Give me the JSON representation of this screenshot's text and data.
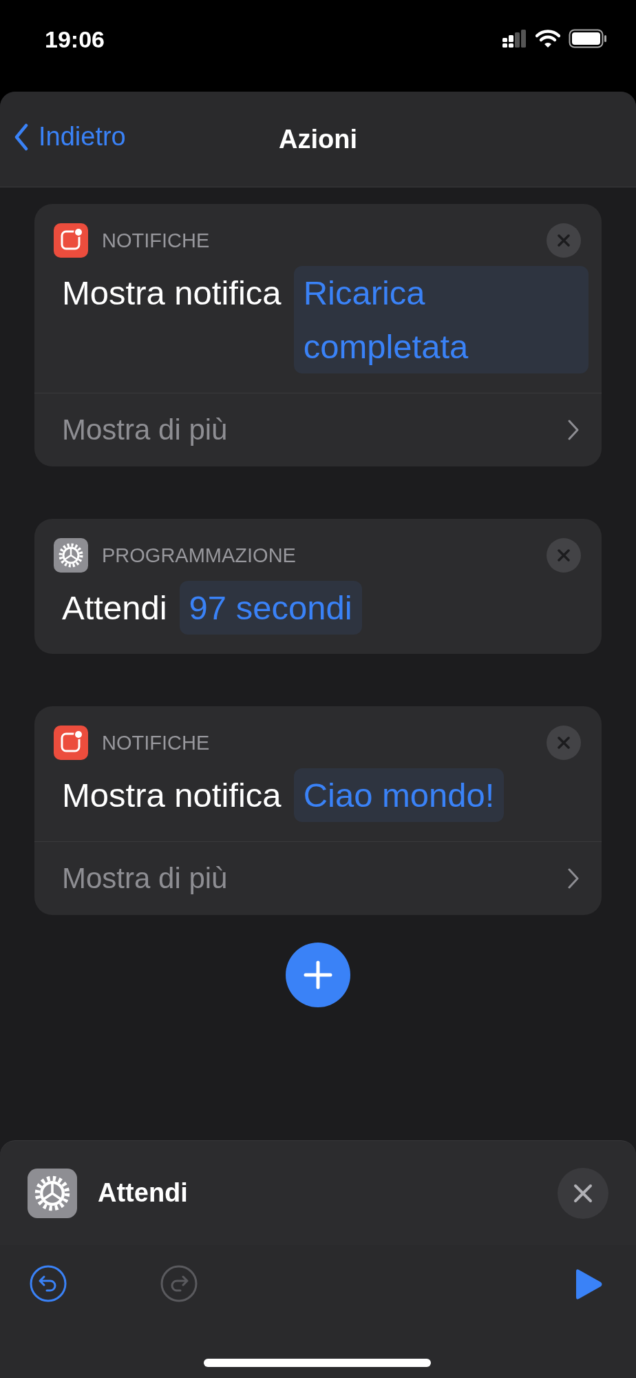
{
  "status_bar": {
    "time": "19:06"
  },
  "nav": {
    "back": "Indietro",
    "title": "Azioni"
  },
  "actions": [
    {
      "kind": "notification",
      "category": "NOTIFICHE",
      "verb": "Mostra notifica",
      "parameter": "Ricarica completata",
      "show_more": "Mostra di più"
    },
    {
      "kind": "scripting",
      "category": "PROGRAMMAZIONE",
      "verb": "Attendi",
      "parameter": "97 secondi"
    },
    {
      "kind": "notification",
      "category": "NOTIFICHE",
      "verb": "Mostra notifica",
      "parameter": "Ciao mondo!",
      "show_more": "Mostra di più"
    }
  ],
  "selected_action": {
    "kind": "scripting",
    "title": "Attendi"
  },
  "toolbar": {
    "undo_disabled": false,
    "redo_disabled": true
  }
}
